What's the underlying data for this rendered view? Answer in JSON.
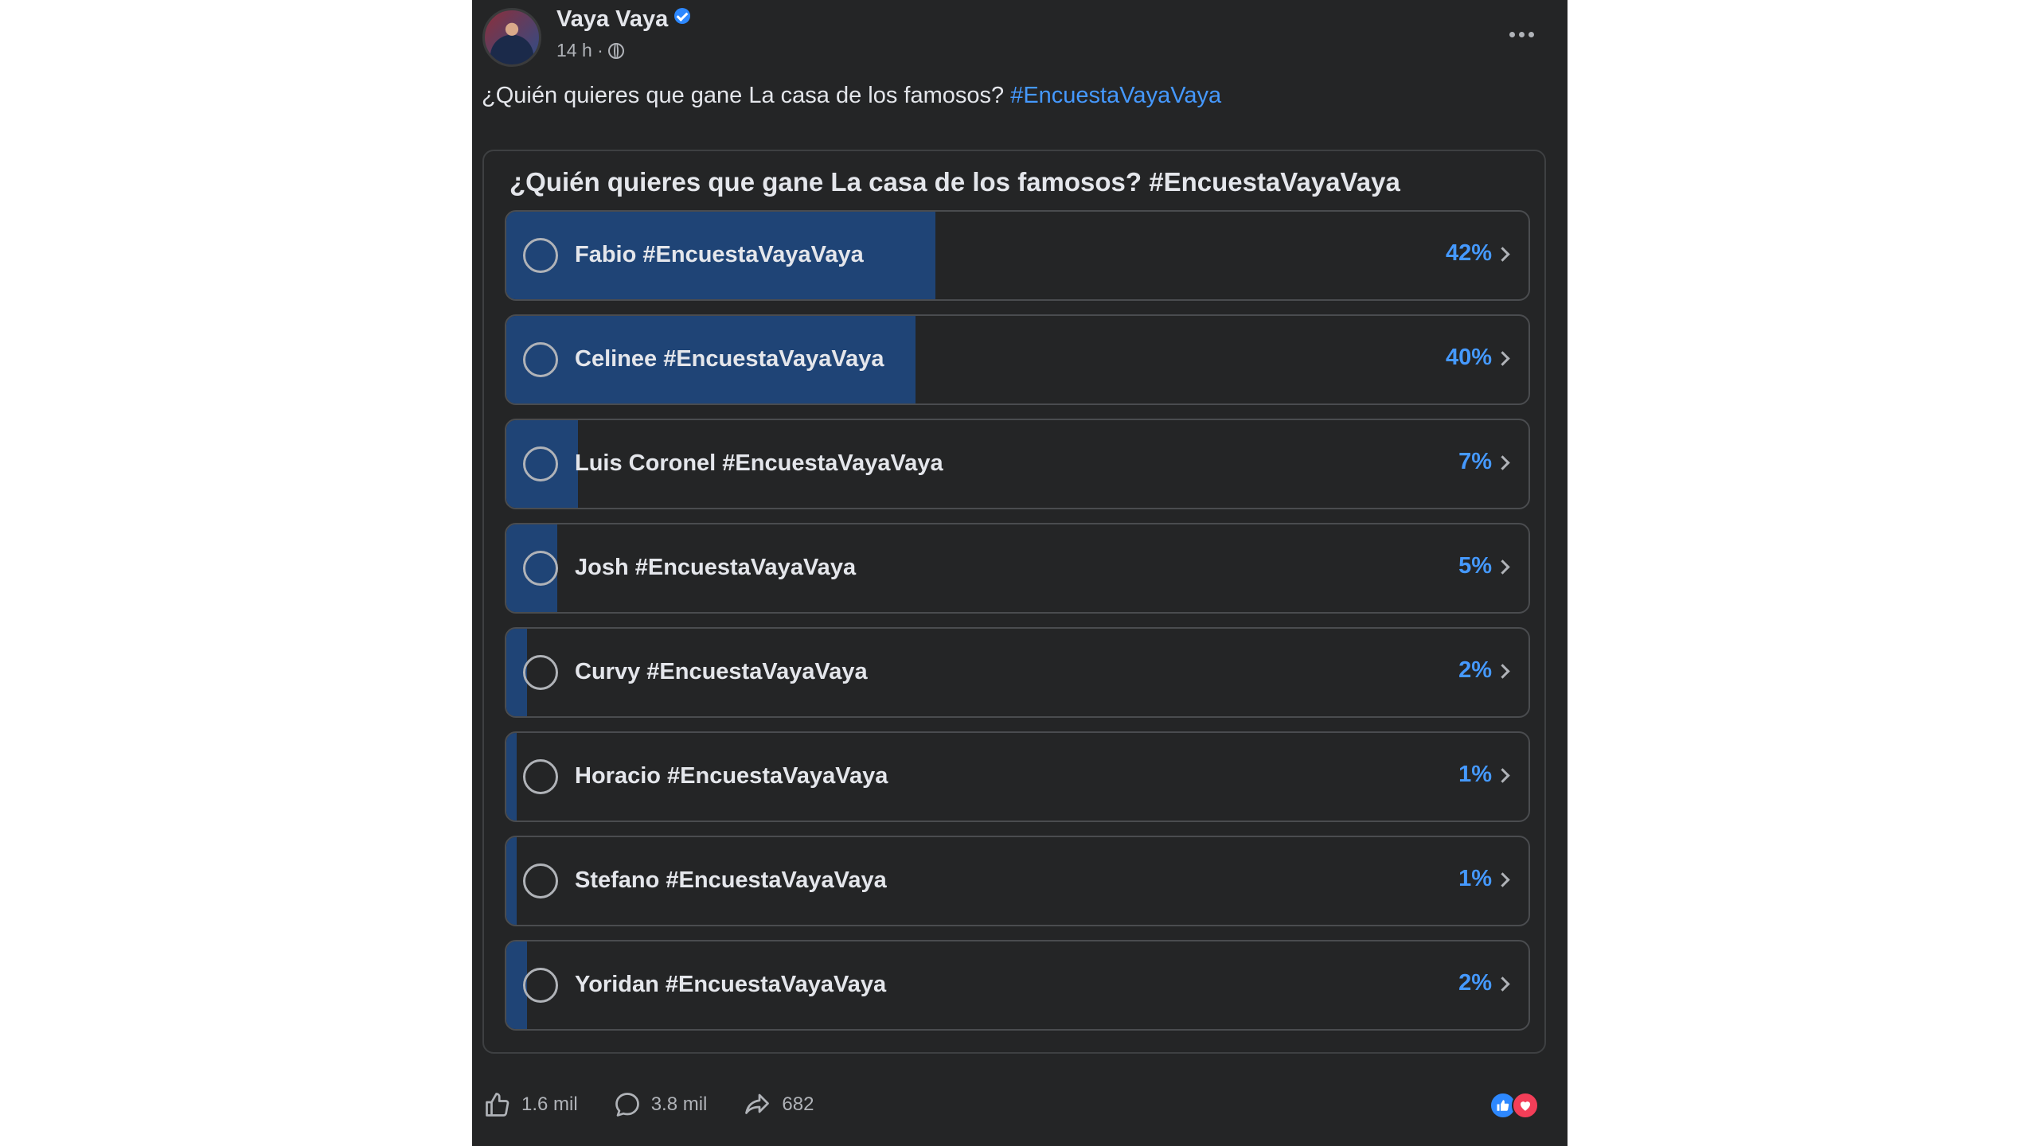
{
  "post": {
    "author": "Vaya Vaya",
    "time": "14 h ·",
    "caption": "¿Quién quieres que gane La casa de los famosos?",
    "caption_hashtag": "#EncuestaVayaVaya"
  },
  "poll": {
    "question": "¿Quién quieres que gane La casa de los famosos? #EncuestaVayaVaya",
    "options": [
      {
        "label": "Fabio #EncuestaVayaVaya",
        "percent": "42%",
        "value": 42
      },
      {
        "label": "Celinee #EncuestaVayaVaya",
        "percent": "40%",
        "value": 40
      },
      {
        "label": "Luis Coronel #EncuestaVayaVaya",
        "percent": "7%",
        "value": 7
      },
      {
        "label": "Josh #EncuestaVayaVaya",
        "percent": "5%",
        "value": 5
      },
      {
        "label": "Curvy #EncuestaVayaVaya",
        "percent": "2%",
        "value": 2
      },
      {
        "label": "Horacio #EncuestaVayaVaya",
        "percent": "1%",
        "value": 1
      },
      {
        "label": "Stefano #EncuestaVayaVaya",
        "percent": "1%",
        "value": 1
      },
      {
        "label": "Yoridan #EncuestaVayaVaya",
        "percent": "2%",
        "value": 2
      }
    ]
  },
  "footer": {
    "likes": "1.6 mil",
    "comments": "3.8 mil",
    "shares": "682"
  },
  "colors": {
    "background": "#242526",
    "poll_fill": "#1f4476",
    "accent": "#4599ff",
    "text": "#e4e6eb",
    "muted": "#b0b3b8"
  },
  "icons": {
    "verified": "verified-badge-icon",
    "audience": "globe-icon",
    "menu": "more-horizontal-icon",
    "like": "thumbs-up-icon",
    "comment": "comment-bubble-icon",
    "share": "share-arrow-icon",
    "reactions": [
      "like-reaction-icon",
      "love-reaction-icon"
    ]
  }
}
